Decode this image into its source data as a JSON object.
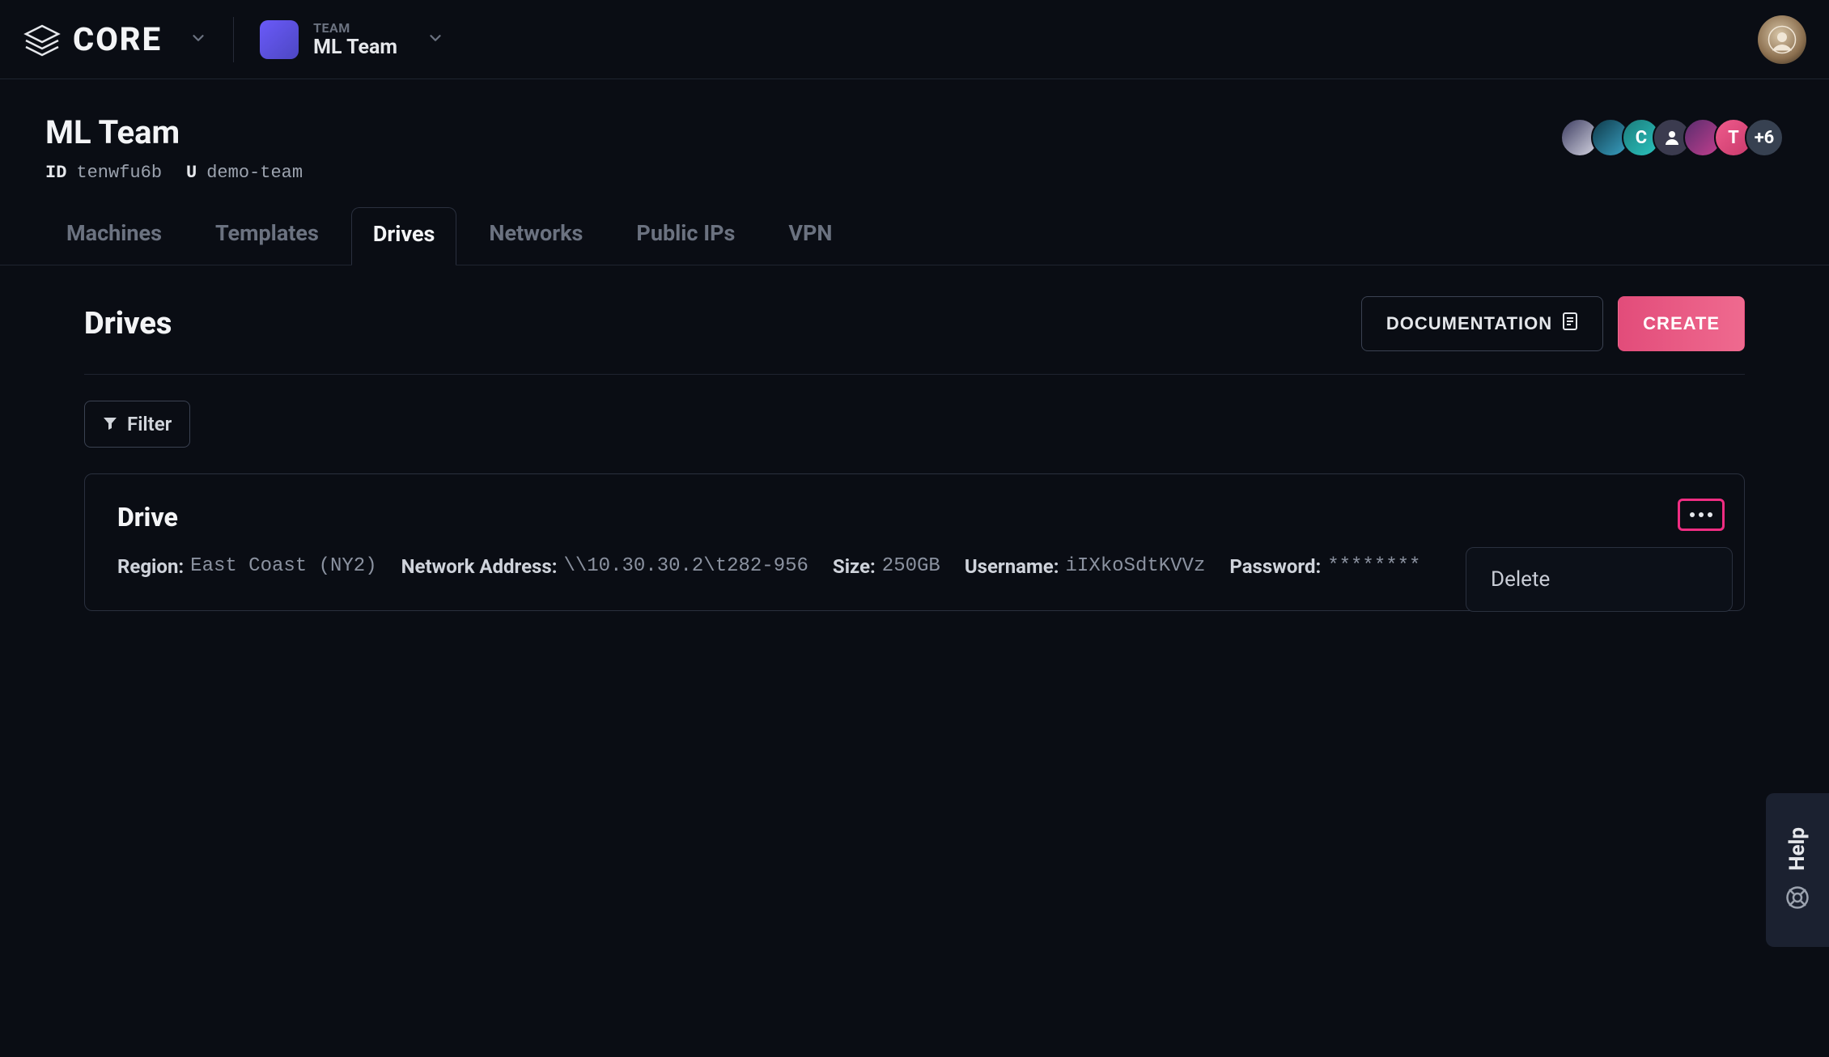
{
  "brand": {
    "name": "CORE"
  },
  "team_selector": {
    "label": "TEAM",
    "name": "ML Team"
  },
  "page": {
    "title": "ML Team",
    "id_label": "ID",
    "id_value": "tenwfu6b",
    "slug_label": "U",
    "slug_value": "demo-team"
  },
  "members": {
    "extra_count": "+6",
    "avatars": {
      "c_letter": "C",
      "t_letter": "T"
    }
  },
  "tabs": [
    {
      "label": "Machines"
    },
    {
      "label": "Templates"
    },
    {
      "label": "Drives",
      "active": true
    },
    {
      "label": "Networks"
    },
    {
      "label": "Public IPs"
    },
    {
      "label": "VPN"
    }
  ],
  "section": {
    "title": "Drives",
    "documentation_label": "DOCUMENTATION",
    "create_label": "CREATE",
    "filter_label": "Filter"
  },
  "drive": {
    "title": "Drive",
    "fields": {
      "region_label": "Region:",
      "region_value": "East Coast (NY2)",
      "network_label": "Network Address:",
      "network_value": "\\\\10.30.30.2\\t282-956",
      "size_label": "Size:",
      "size_value": "250GB",
      "username_label": "Username:",
      "username_value": "iIXkoSdtKVVz",
      "password_label": "Password:",
      "password_value": "********"
    },
    "menu": {
      "delete_label": "Delete"
    }
  },
  "help": {
    "label": "Help"
  }
}
